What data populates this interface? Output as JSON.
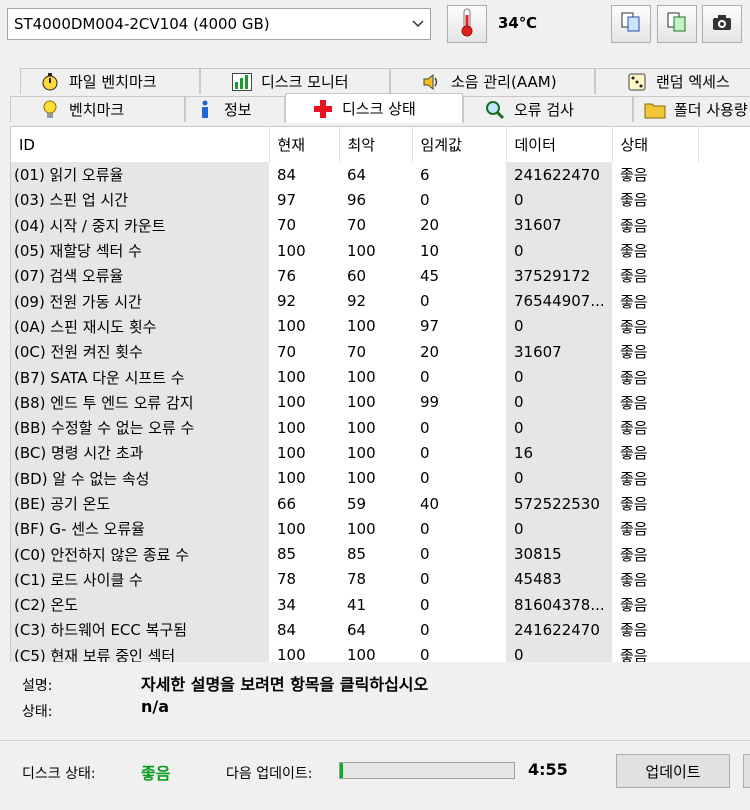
{
  "header": {
    "drive": "ST4000DM004-2CV104 (4000 GB)",
    "temperature": "34℃"
  },
  "tabs_row1": [
    "파일 벤치마크",
    "디스크 모니터",
    "소음 관리(AAM)",
    "랜덤 엑세스"
  ],
  "tabs_row2": [
    "벤치마크",
    "정보",
    "디스크 상태",
    "오류 검사",
    "폴더 사용량"
  ],
  "table": {
    "columns": [
      "ID",
      "현재",
      "최악",
      "임계값",
      "데이터",
      "상태"
    ],
    "rows": [
      [
        "(01) 읽기 오류율",
        "84",
        "64",
        "6",
        "241622470",
        "좋음"
      ],
      [
        "(03) 스핀 업 시간",
        "97",
        "96",
        "0",
        "0",
        "좋음"
      ],
      [
        "(04) 시작 / 중지 카운트",
        "70",
        "70",
        "20",
        "31607",
        "좋음"
      ],
      [
        "(05) 재할당 섹터 수",
        "100",
        "100",
        "10",
        "0",
        "좋음"
      ],
      [
        "(07) 검색 오류율",
        "76",
        "60",
        "45",
        "37529172",
        "좋음"
      ],
      [
        "(09) 전원 가동 시간",
        "92",
        "92",
        "0",
        "76544907...",
        "좋음"
      ],
      [
        "(0A) 스핀 재시도 횟수",
        "100",
        "100",
        "97",
        "0",
        "좋음"
      ],
      [
        "(0C) 전원 켜진 횟수",
        "70",
        "70",
        "20",
        "31607",
        "좋음"
      ],
      [
        "(B7) SATA 다운 시프트 수",
        "100",
        "100",
        "0",
        "0",
        "좋음"
      ],
      [
        "(B8) 엔드 투 엔드 오류 감지",
        "100",
        "100",
        "99",
        "0",
        "좋음"
      ],
      [
        "(BB) 수정할 수 없는 오류 수",
        "100",
        "100",
        "0",
        "0",
        "좋음"
      ],
      [
        "(BC) 명령 시간 초과",
        "100",
        "100",
        "0",
        "16",
        "좋음"
      ],
      [
        "(BD) 알 수 없는 속성",
        "100",
        "100",
        "0",
        "0",
        "좋음"
      ],
      [
        "(BE) 공기 온도",
        "66",
        "59",
        "40",
        "572522530",
        "좋음"
      ],
      [
        "(BF) G- 센스 오류율",
        "100",
        "100",
        "0",
        "0",
        "좋음"
      ],
      [
        "(C0) 안전하지 않은 종료 수",
        "85",
        "85",
        "0",
        "30815",
        "좋음"
      ],
      [
        "(C1) 로드 사이클 수",
        "78",
        "78",
        "0",
        "45483",
        "좋음"
      ],
      [
        "(C2) 온도",
        "34",
        "41",
        "0",
        "81604378...",
        "좋음"
      ],
      [
        "(C3) 하드웨어 ECC 복구됨",
        "84",
        "64",
        "0",
        "241622470",
        "좋음"
      ],
      [
        "(C5) 현재 보류 중인 섹터",
        "100",
        "100",
        "0",
        "0",
        "좋음"
      ]
    ]
  },
  "details": {
    "desc_label": "설명:",
    "desc_value": "자세한 설명을 보려면 항목을 클릭하십시오",
    "status_label": "상태:",
    "status_value": "n/a"
  },
  "footer": {
    "disk_status_label": "디스크 상태:",
    "disk_status_value": "좋음",
    "next_update_label": "다음 업데이트:",
    "countdown": "4:55",
    "progress_fraction": 0.02,
    "update_button": "업데이트"
  },
  "colors": {
    "good": "#0a9b1e",
    "progress": "#06b025"
  }
}
